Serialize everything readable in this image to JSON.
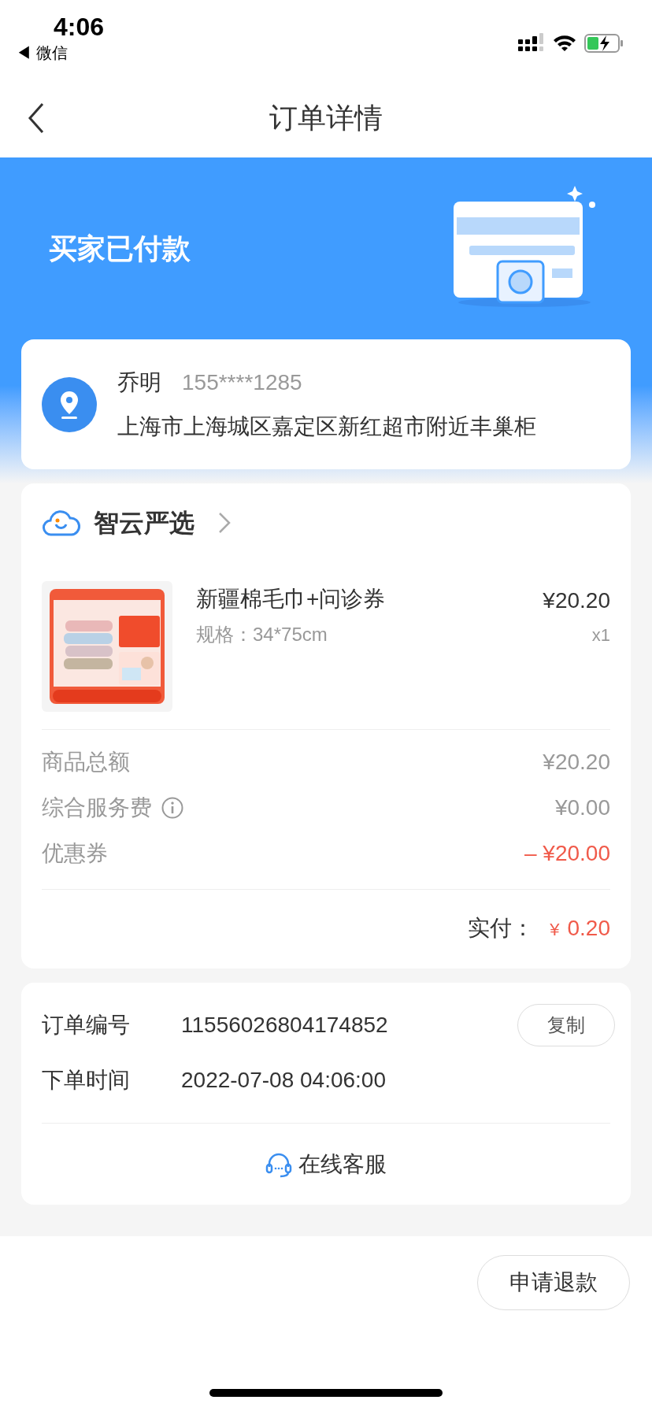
{
  "status_bar": {
    "time": "4:06",
    "back_app": "◀ 微信"
  },
  "nav": {
    "title": "订单详情"
  },
  "header": {
    "status": "买家已付款"
  },
  "address": {
    "name": "乔明",
    "phone": "155****1285",
    "address": "上海市上海城区嘉定区新红超市附近丰巢柜"
  },
  "store": {
    "name": "智云严选",
    "product": {
      "kind": "picture",
      "title": "新疆棉毛巾+问诊券",
      "spec": "规格：34*75cm",
      "price": "¥20.20",
      "quantity": "x1"
    },
    "fees": [
      {
        "label": "商品总额",
        "value": "¥20.20",
        "info": false,
        "highlight": false
      },
      {
        "label": "综合服务费",
        "value": "¥0.00",
        "info": true,
        "highlight": false
      },
      {
        "label": "优惠券",
        "value": "– ¥20.00",
        "info": false,
        "highlight": true
      }
    ],
    "paid_label": "实付：",
    "paid_currency": "¥",
    "paid_amount": "0.20"
  },
  "order_info": {
    "rows": [
      {
        "label": "订单编号",
        "value": "11556026804174852",
        "action": "复制"
      },
      {
        "label": "下单时间",
        "value": "2022-07-08 04:06:00"
      }
    ],
    "service": "在线客服"
  },
  "footer": {
    "button": "申请退款"
  }
}
